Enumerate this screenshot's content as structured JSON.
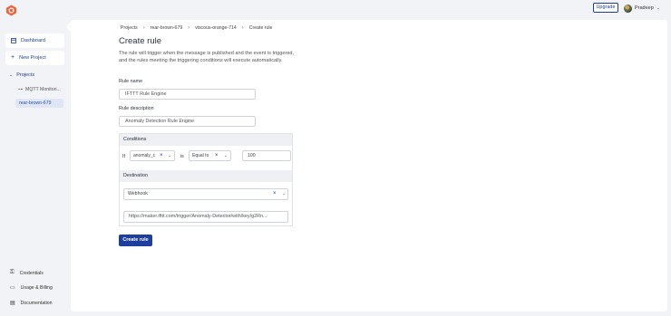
{
  "header": {
    "upgrade_label": "Upgrade",
    "user_name": "Pradeep"
  },
  "sidebar": {
    "dashboard_label": "Dashboard",
    "new_project_label": "New Project",
    "projects_label": "Projects",
    "projects": [
      "MQTT Monitori...",
      "rear-brown-679"
    ],
    "credentials_label": "Credentials",
    "usage_label": "Usage & Billing",
    "docs_label": "Documentation"
  },
  "breadcrumb": [
    "Projects",
    "rear-brown-679",
    "viscous-orange-714",
    "Create rule"
  ],
  "page": {
    "title": "Create rule",
    "description": "The rule will trigger when the message is published and the event is triggered, and the rules meeting the triggering conditions will execute automatically."
  },
  "form": {
    "rule_name_label": "Rule name",
    "rule_name_value": "IFTTT Rule Engine",
    "rule_desc_label": "Rule description",
    "rule_desc_value": "Anomaly Detection Rule Engine",
    "conditions_label": "Conditions",
    "if_label": "If",
    "field_value": "anomaly_c",
    "is_label": "is",
    "operator_value": "Equal to",
    "threshold_value": "100",
    "destination_label": "Destination",
    "destination_value": "Webhook",
    "url_value": "https://maker.ifttt.com/trigger/Anomaly-Detector/with/key/g2Rn...",
    "submit_label": "Create rule"
  },
  "colors": {
    "primary": "#1f3f9f",
    "background": "#f2f3f6",
    "active_nav": "#dfe7f7"
  }
}
